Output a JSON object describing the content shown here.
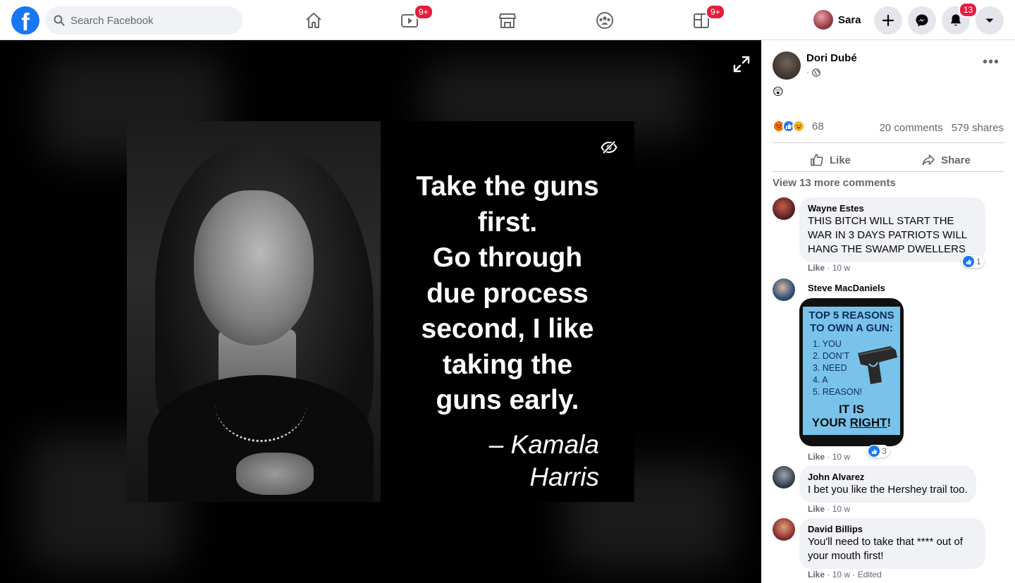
{
  "topbar": {
    "search_placeholder": "Search Facebook",
    "watch_badge": "9+",
    "gaming_badge": "9+",
    "profile_name": "Sara",
    "notifications_badge": "13",
    "brand_color": "#1877f2",
    "badge_color": "#e41e3f"
  },
  "meme": {
    "quote_lines": [
      "Take the guns",
      "first.",
      "Go through",
      "due process",
      "second, I like",
      "taking the",
      "guns early."
    ],
    "attribution_lines": [
      "– Kamala",
      "Harris"
    ]
  },
  "post": {
    "author": "Dori Dubé",
    "meta_dot": "·",
    "text": "😲",
    "reaction_count": "68",
    "comments_count": "20 comments",
    "shares_count": "579 shares",
    "like_label": "Like",
    "share_label": "Share",
    "view_more": "View 13 more comments"
  },
  "comments": [
    {
      "author": "Wayne Estes",
      "text": "THIS BITCH WILL START THE WAR IN 3 DAYS PATRIOTS WILL HANG THE SWAMP DWELLERS",
      "like": "Like",
      "time": "10 w",
      "reactions": "1"
    },
    {
      "author": "Steve MacDaniels",
      "like": "Like",
      "time": "10 w",
      "reactions": "3",
      "image": {
        "head": "TOP 5 REASONS TO OWN A GUN:",
        "items": [
          "1. YOU",
          "2. DON’T",
          "3. NEED",
          "4. A",
          "5. REASON!"
        ],
        "tag_line1": "IT IS",
        "tag_line2a": "YOUR ",
        "tag_line2b": "RIGHT",
        "tag_line2c": "!"
      }
    },
    {
      "author": "John Alvarez",
      "text": "I bet you like the Hershey trail too.",
      "like": "Like",
      "time": "10 w"
    },
    {
      "author": "David Billips",
      "text": "You'll need to take that **** out of your mouth first!",
      "like": "Like",
      "time": "10 w",
      "edited": "Edited"
    }
  ]
}
